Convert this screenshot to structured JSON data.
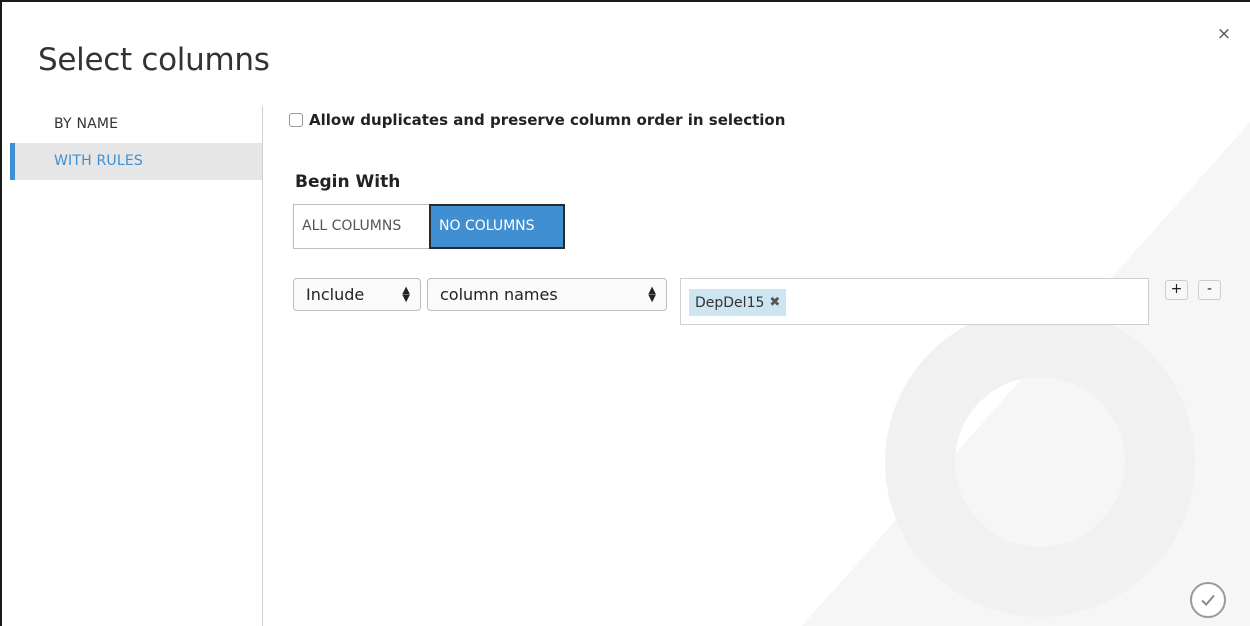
{
  "dialog": {
    "title": "Select columns",
    "close_icon": "close-icon"
  },
  "sidebar": {
    "items": [
      {
        "label": "BY NAME",
        "active": false
      },
      {
        "label": "WITH RULES",
        "active": true
      }
    ]
  },
  "options": {
    "allow_duplicates_label": "Allow duplicates and preserve column order in selection",
    "allow_duplicates_checked": false
  },
  "begin_with": {
    "label": "Begin With",
    "all_label": "ALL COLUMNS",
    "none_label": "NO COLUMNS",
    "selected": "NO COLUMNS"
  },
  "rule": {
    "mode": "Include",
    "kind": "column names",
    "tags": [
      "DepDel15"
    ],
    "add_label": "+",
    "remove_label": "-"
  },
  "footer": {
    "ok_icon": "checkmark-icon"
  },
  "colors": {
    "accent": "#3f8fd2",
    "tag_bg": "#cde4f1",
    "active_item_bg": "#e6e6e6"
  }
}
